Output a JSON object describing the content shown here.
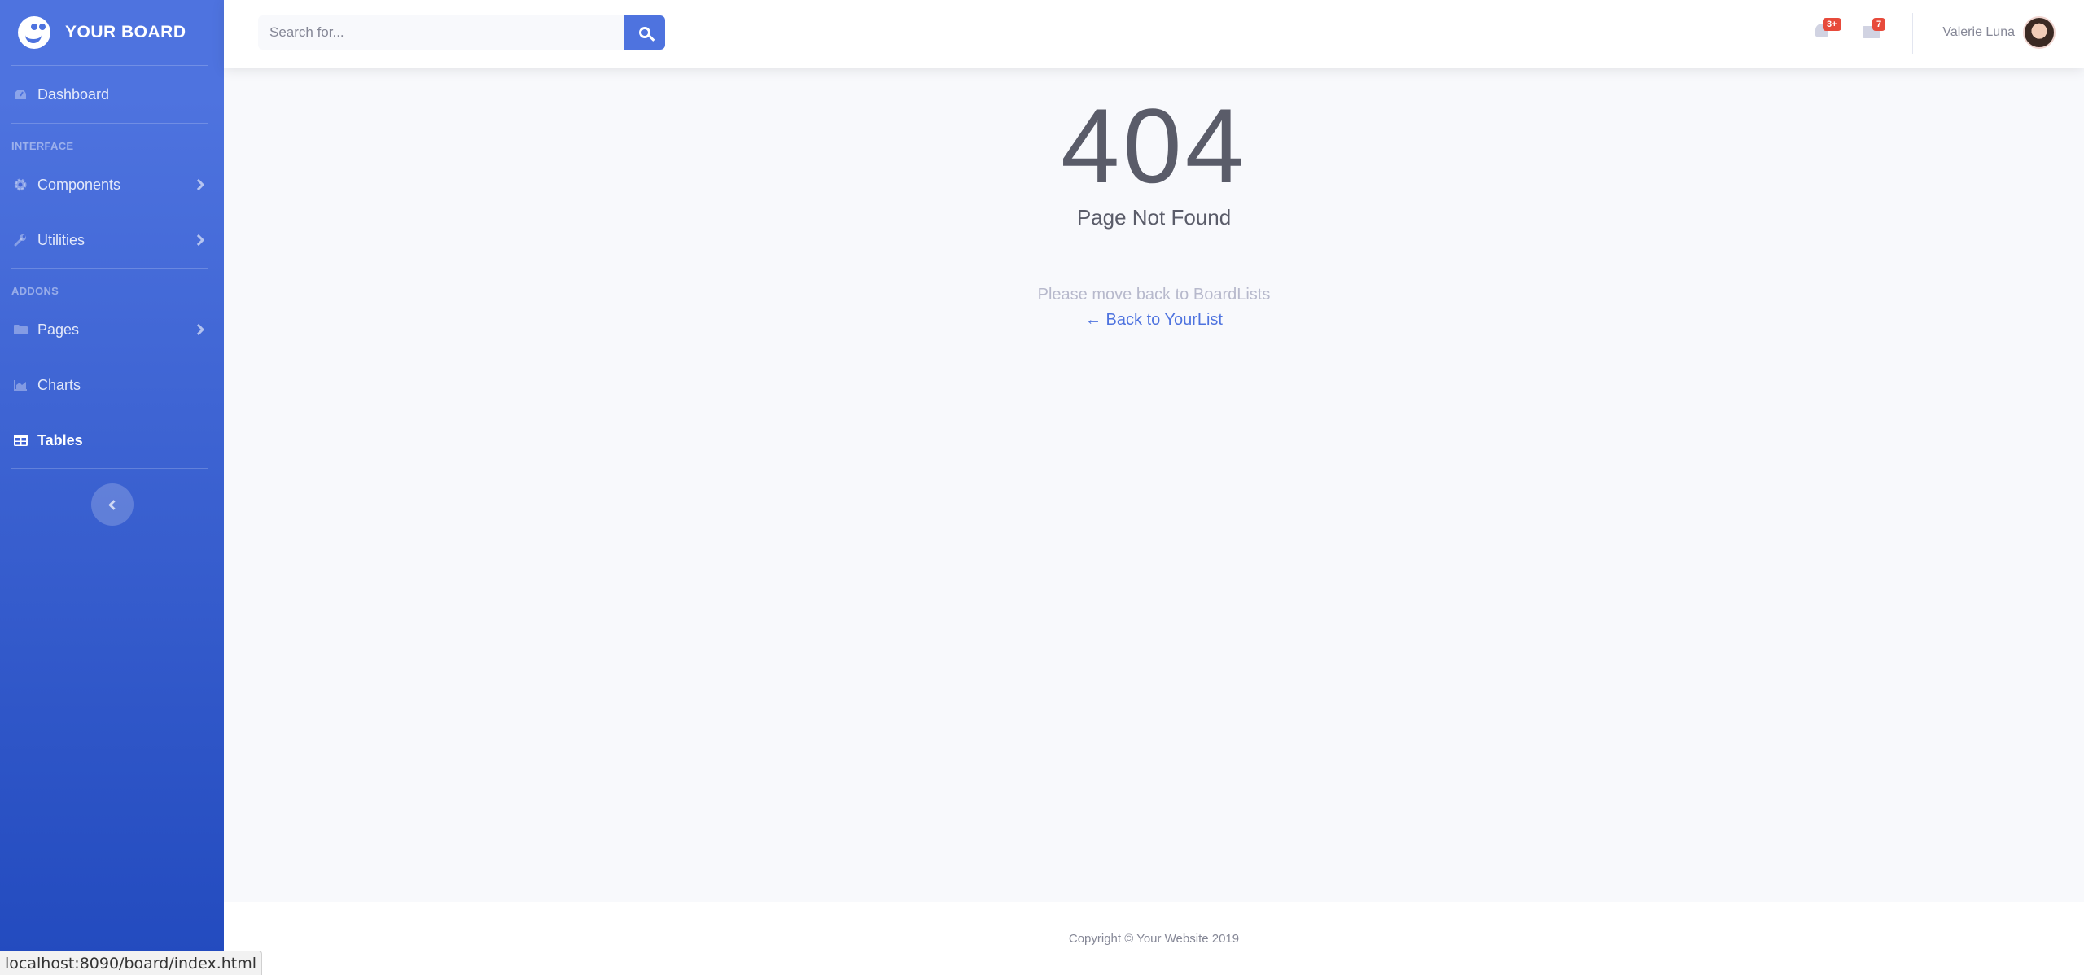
{
  "sidebar": {
    "brand": "YOUR BOARD",
    "items": [
      {
        "label": "Dashboard",
        "icon": "tachometer-icon"
      },
      {
        "label": "Components",
        "icon": "cog-icon"
      },
      {
        "label": "Utilities",
        "icon": "wrench-icon"
      },
      {
        "label": "Pages",
        "icon": "folder-icon"
      },
      {
        "label": "Charts",
        "icon": "chart-area-icon"
      },
      {
        "label": "Tables",
        "icon": "table-icon"
      }
    ],
    "headings": [
      "Interface",
      "Addons"
    ]
  },
  "topbar": {
    "search_placeholder": "Search for...",
    "alerts_badge": "3+",
    "messages_badge": "7",
    "user_name": "Valerie Luna"
  },
  "main": {
    "error_code": "404",
    "error_title": "Page Not Found",
    "message": "Please move back to BoardLists",
    "back_link": "← Back to YourList"
  },
  "footer": {
    "copyright": "Copyright © Your Website 2019"
  },
  "status_bar": {
    "url": "localhost:8090/board/index.html"
  },
  "colors": {
    "primary": "#4e73df",
    "primary_dark": "#224abe",
    "badge_red": "#e74a3b",
    "text_gray": "#5a5c69"
  }
}
